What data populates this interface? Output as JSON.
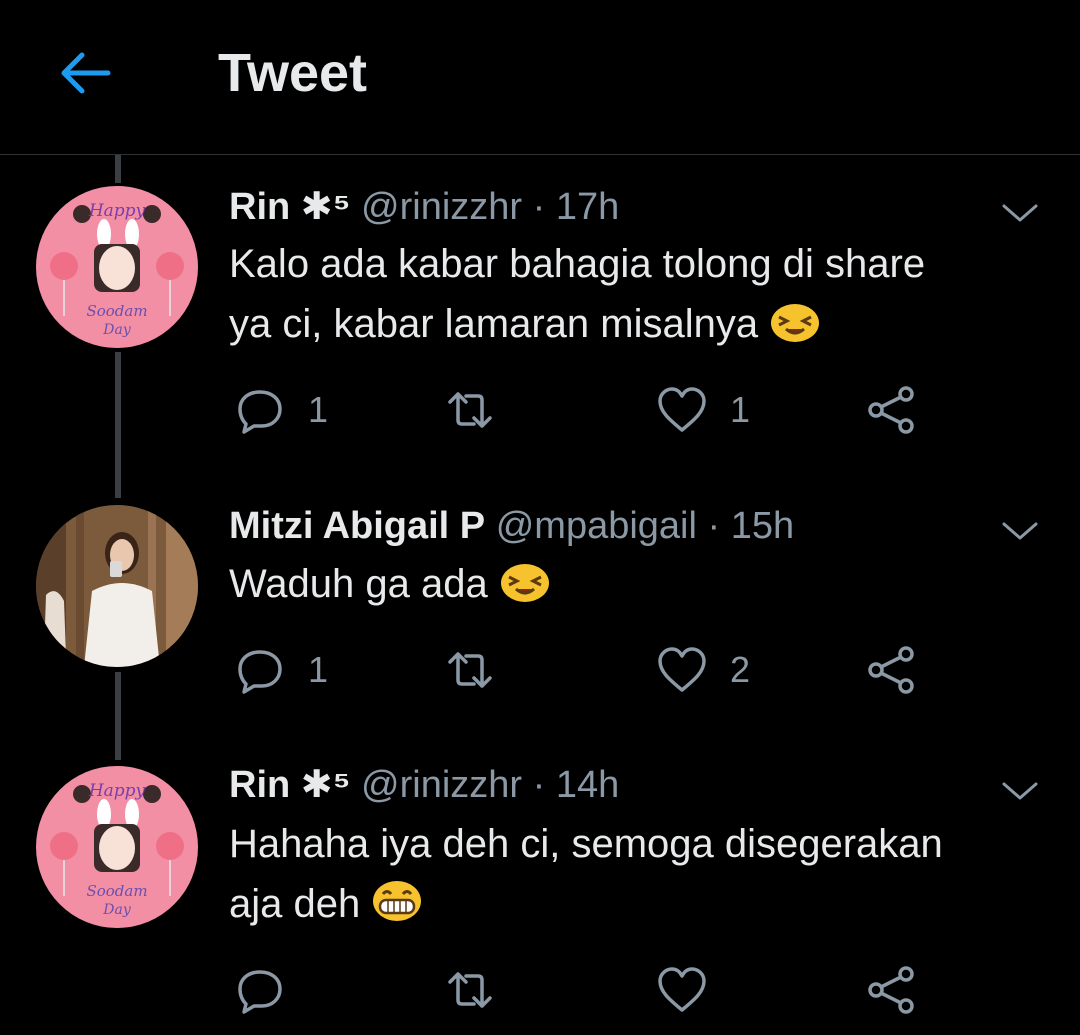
{
  "header": {
    "title": "Tweet",
    "back_icon": "arrow-left-icon",
    "accent": "#1d9bf0"
  },
  "tweets": [
    {
      "name": "Rin ✱⁵",
      "handle": "@rinizzhr",
      "separator": "·",
      "time": "17h",
      "text_line1": "Kalo ada kabar bahagia tolong di share",
      "text_line2": "ya ci, kabar lamaran misalnya",
      "emoji": "squinting-face-emoji",
      "replies": "1",
      "retweets": "",
      "likes": "1",
      "avatar_text_top": "Happy",
      "avatar_text_bottom": "Soodam",
      "avatar_text_day": "Day"
    },
    {
      "name": "Mitzi Abigail P",
      "handle": "@mpabigail",
      "separator": "·",
      "time": "15h",
      "text_line1": "Waduh ga ada",
      "text_line2": "",
      "emoji": "squinting-face-emoji",
      "replies": "1",
      "retweets": "",
      "likes": "2"
    },
    {
      "name": "Rin ✱⁵",
      "handle": "@rinizzhr",
      "separator": "·",
      "time": "14h",
      "text_line1": "Hahaha iya deh ci, semoga disegerakan",
      "text_line2": "aja deh",
      "emoji": "grinning-face-emoji",
      "replies": "",
      "retweets": "",
      "likes": "",
      "avatar_text_top": "Happy",
      "avatar_text_bottom": "Soodam",
      "avatar_text_day": "Day"
    }
  ]
}
